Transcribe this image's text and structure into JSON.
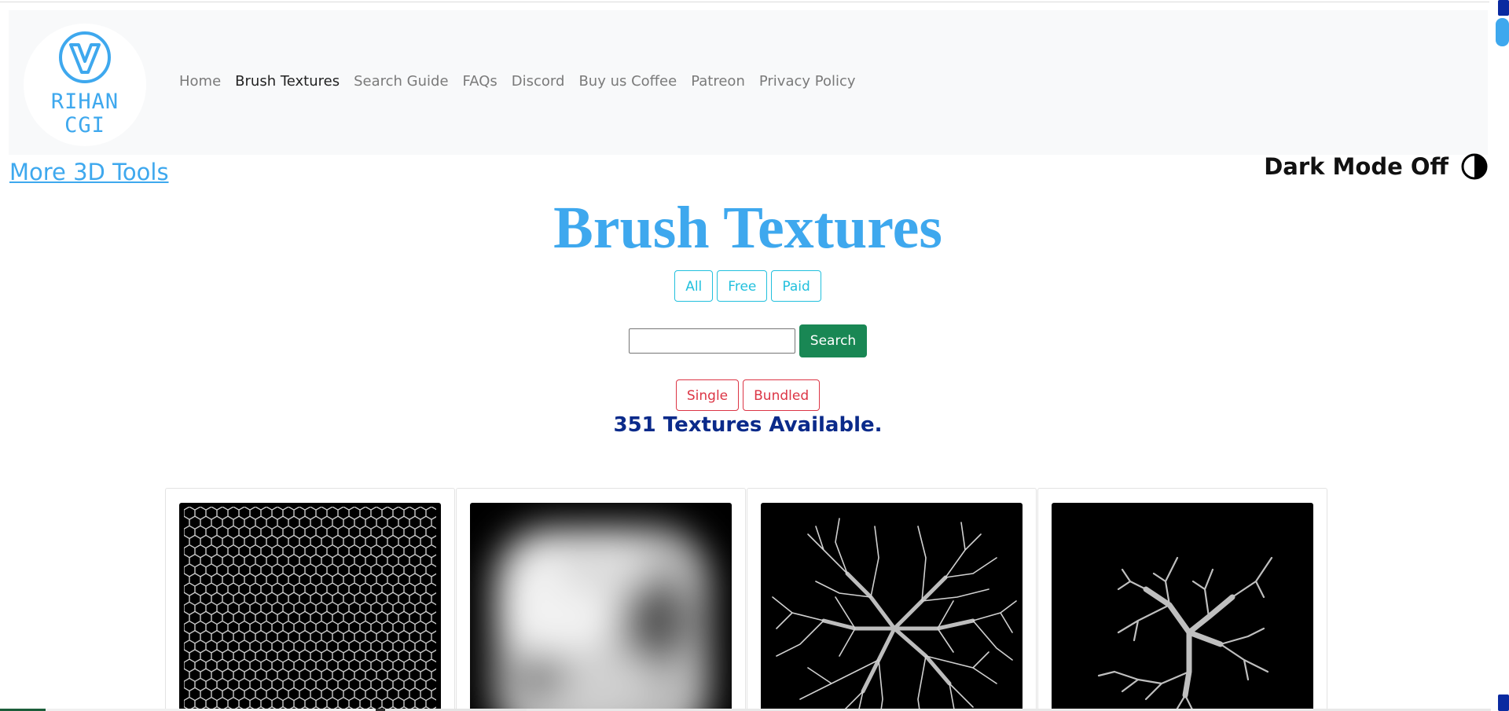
{
  "logo": {
    "line1": "RIHAN",
    "line2": "CGI",
    "brand_color": "#3ea8ee"
  },
  "nav": {
    "items": [
      {
        "label": "Home",
        "active": false
      },
      {
        "label": "Brush Textures",
        "active": true
      },
      {
        "label": "Search Guide",
        "active": false
      },
      {
        "label": "FAQs",
        "active": false
      },
      {
        "label": "Discord",
        "active": false
      },
      {
        "label": "Buy us Coffee",
        "active": false
      },
      {
        "label": "Patreon",
        "active": false
      },
      {
        "label": "Privacy Policy",
        "active": false
      }
    ]
  },
  "more_tools": "More 3D Tools",
  "dark_mode": {
    "label": "Dark Mode Off",
    "icon": "contrast-icon"
  },
  "title": "Brush Textures",
  "filters": {
    "all": "All",
    "free": "Free",
    "paid": "Paid"
  },
  "search": {
    "value": "",
    "placeholder": "",
    "button": "Search"
  },
  "types": {
    "single": "Single",
    "bundled": "Bundled"
  },
  "count_text": "351 Textures Available.",
  "cards": [
    {
      "texture": "hexagon-grid"
    },
    {
      "texture": "cloudy-noise"
    },
    {
      "texture": "dense-branches"
    },
    {
      "texture": "sparse-branches"
    }
  ],
  "colors": {
    "accent": "#3ea8ee",
    "info": "#22c0dd",
    "danger": "#dc3545",
    "success": "#198754",
    "count": "#0a2a8a"
  }
}
